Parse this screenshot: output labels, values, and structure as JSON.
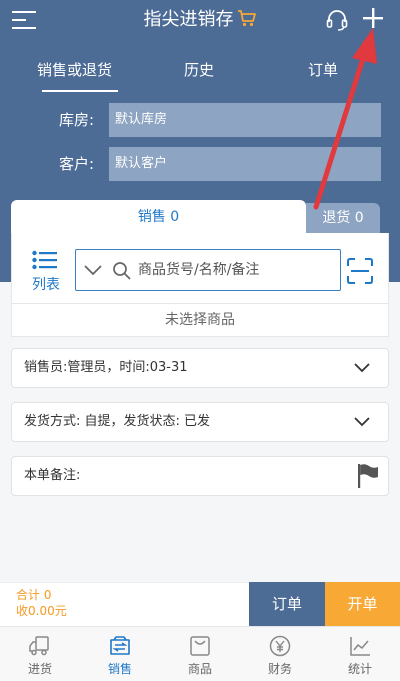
{
  "header": {
    "title": "指尖进销存",
    "icons": {
      "menu": "menu-icon",
      "cart": "cart-icon",
      "service": "headset-icon",
      "add": "plus-icon"
    }
  },
  "tabs": [
    {
      "label": "销售或退货",
      "active": true
    },
    {
      "label": "历史",
      "active": false
    },
    {
      "label": "订单",
      "active": false
    }
  ],
  "form": {
    "warehouse_label": "库房:",
    "warehouse_value": "默认库房",
    "customer_label": "客户:",
    "customer_value": "默认客户"
  },
  "sale_tabs": {
    "sales": "销售 0",
    "returns": "退货 0"
  },
  "product_area": {
    "list_label": "列表",
    "search_placeholder": "商品货号/名称/备注",
    "search_value": "",
    "empty_text": "未选择商品"
  },
  "info_rows": {
    "salesperson": "销售员:管理员，时间:03-31",
    "shipping": "发货方式: 自提，发货状态: 已发",
    "remark": "本单备注:"
  },
  "footer": {
    "total_count": "合计 0",
    "total_amount": "收0.00元",
    "order_button": "订单",
    "submit_button": "开单"
  },
  "bottom_nav": [
    {
      "label": "进货",
      "icon": "truck-icon",
      "active": false
    },
    {
      "label": "销售",
      "icon": "sales-icon",
      "active": true
    },
    {
      "label": "商品",
      "icon": "product-icon",
      "active": false
    },
    {
      "label": "财务",
      "icon": "yuan-icon",
      "active": false
    },
    {
      "label": "统计",
      "icon": "chart-icon",
      "active": false
    }
  ],
  "colors": {
    "header_bg": "#4c6b95",
    "field_bg": "#8da4c2",
    "accent_blue": "#1f78c8",
    "accent_orange": "#f7a835",
    "annotation_red": "#e0393e"
  }
}
